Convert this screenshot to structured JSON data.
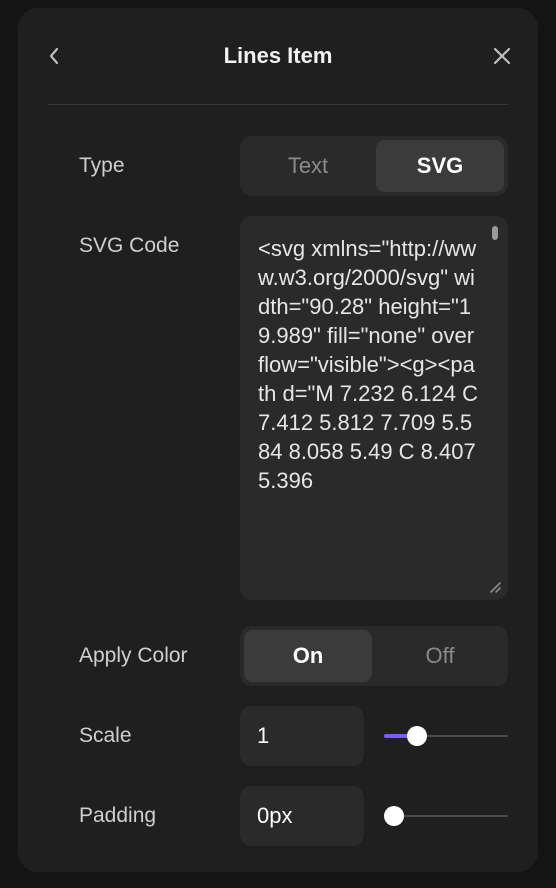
{
  "header": {
    "title": "Lines Item",
    "back_icon": "chevron-left-icon",
    "close_icon": "close-icon"
  },
  "type_row": {
    "label": "Type",
    "options": [
      "Text",
      "SVG"
    ],
    "selected": "SVG"
  },
  "svg_code_row": {
    "label": "SVG Code",
    "value": "<svg xmlns=\"http://www.w3.org/2000/svg\" width=\"90.28\" height=\"19.989\" fill=\"none\" overflow=\"visible\"><g><path d=\"M 7.232 6.124 C 7.412 5.812 7.709 5.584 8.058 5.49 C 8.407 5.396"
  },
  "apply_color_row": {
    "label": "Apply Color",
    "options": [
      "On",
      "Off"
    ],
    "selected": "On"
  },
  "scale_row": {
    "label": "Scale",
    "value": "1",
    "slider_fraction": 0.22
  },
  "padding_row": {
    "label": "Padding",
    "value": "0px",
    "slider_fraction": 0.0
  },
  "colors": {
    "accent": "#7c5cff",
    "panel": "#1f1f1f",
    "control": "#2a2a2a"
  }
}
